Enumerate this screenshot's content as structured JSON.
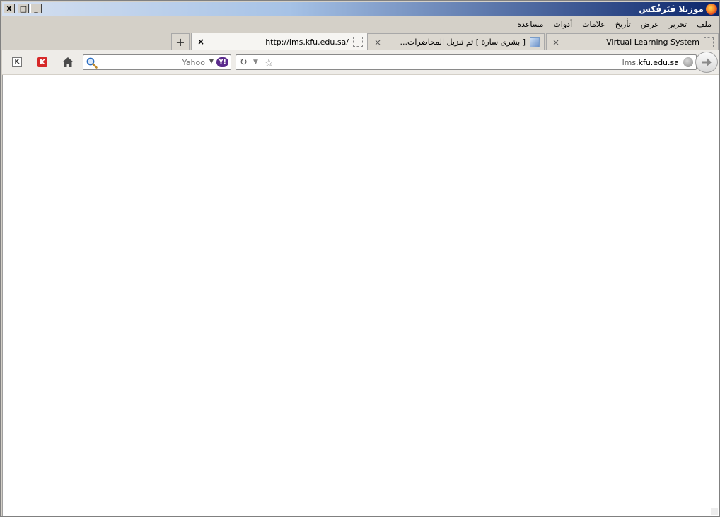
{
  "window": {
    "title": "موزيلا فَيَرفُكس",
    "buttons": {
      "minimize": "_",
      "maximize": "□",
      "close": "X"
    }
  },
  "menu": [
    {
      "label": "ملف"
    },
    {
      "label": "تحرير"
    },
    {
      "label": "عرض"
    },
    {
      "label": "تأريخ"
    },
    {
      "label": "علامات"
    },
    {
      "label": "أدوات"
    },
    {
      "label": "مساعدة"
    }
  ],
  "tabs": [
    {
      "label": "Virtual Learning System",
      "active": false,
      "favicon": "blank-page-icon"
    },
    {
      "label": "[ بشرى سارة ] تم تنزيل المحاضرات...",
      "active": false,
      "favicon": "image-icon"
    },
    {
      "label": "http://lms.kfu.edu.sa/",
      "active": true,
      "favicon": "blank-page-icon"
    }
  ],
  "tab_close_glyph": "×",
  "new_tab_glyph": "+",
  "search": {
    "placeholder": "Yahoo",
    "engine_badge": "Y!"
  },
  "urlbar": {
    "prefix": "lms.",
    "host": "kfu.edu.sa"
  },
  "toolbar_icons": [
    "k-icon",
    "kaspersky-icon",
    "home-icon"
  ]
}
